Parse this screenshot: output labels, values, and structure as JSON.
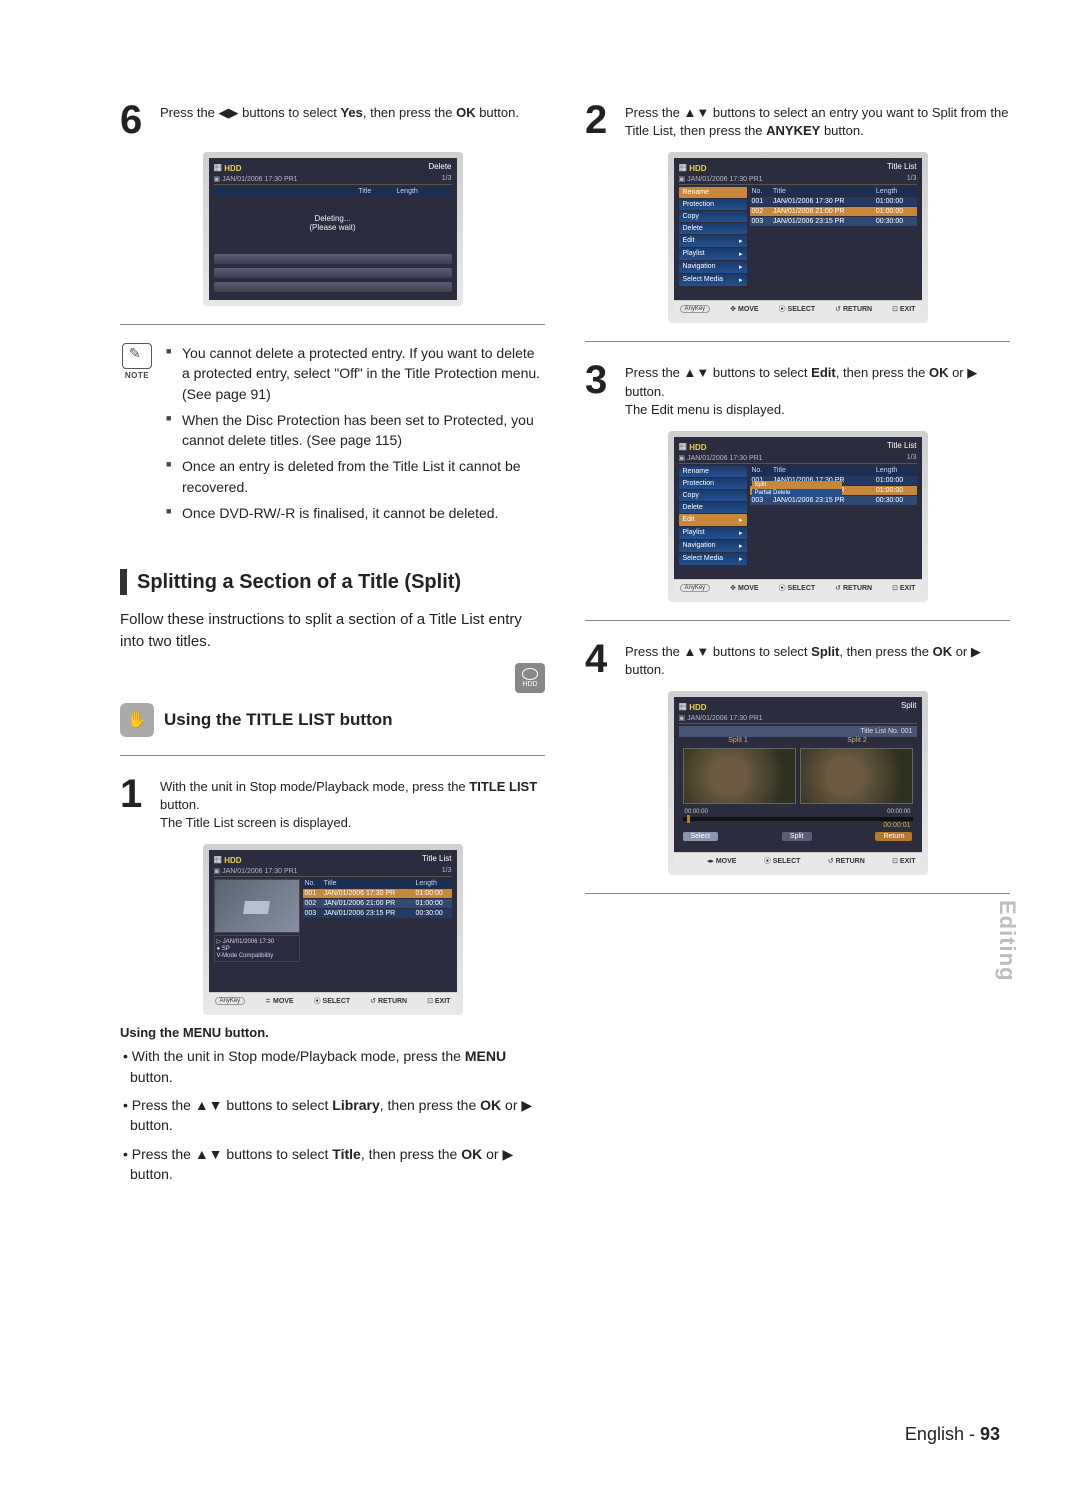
{
  "glyphs": {
    "left_right": "◀▶",
    "up_down": "▲▼",
    "play": "▶",
    "move4": "✥",
    "updown_small": "≑"
  },
  "left": {
    "step6": {
      "num": "6",
      "text_a": "Press the ",
      "text_b": " buttons to select ",
      "bold1": "Yes",
      "text_c": ", then press the ",
      "bold2": "OK",
      "text_d": " button."
    },
    "tv6": {
      "top_l": "HDD",
      "top_r": "Delete",
      "sub_l": "JAN/01/2006 17:30 PR1",
      "sub_r": "1/3",
      "thead": [
        "Title",
        "Length"
      ],
      "mid1": "Deleting...",
      "mid2": "(Please wait)"
    },
    "notes": [
      "You cannot delete a protected entry. If you want to delete a protected entry, select \"Off\" in the Title Protection menu. (See page 91)",
      "When the Disc Protection has been set to Protected, you cannot delete titles. (See page 115)",
      "Once an entry is deleted from the Title List it cannot be recovered.",
      "Once DVD-RW/-R is finalised, it cannot be deleted."
    ],
    "note_label": "NOTE",
    "section_title": "Splitting a Section of a Title (Split)",
    "section_body": "Follow these instructions to split a section of a Title List entry into two titles.",
    "hdd_label": "HDD",
    "sub_title": "Using the TITLE LIST button",
    "step1": {
      "num": "1",
      "text_a": "With the unit in Stop mode/Playback mode, press the ",
      "bold1": "TITLE LIST",
      "text_b": " button.",
      "text_c": "The Title List screen is displayed."
    },
    "tv1": {
      "top_l": "HDD",
      "top_r": "Title List",
      "sub_l": "JAN/01/2006 17:30 PR1",
      "sub_r": "1/3",
      "thead": [
        "No.",
        "Title",
        "Length"
      ],
      "rows": [
        [
          "001",
          "JAN/01/2006 17:30 PR",
          "01:00:00"
        ],
        [
          "002",
          "JAN/01/2006 21:00 PR",
          "01:00:00"
        ],
        [
          "003",
          "JAN/01/2006 23:15 PR",
          "00:30:00"
        ]
      ],
      "info": [
        "JAN/01/2006 17:30",
        "SP",
        "V-Mode Compatibility"
      ]
    },
    "menu_head": "Using the MENU button.",
    "menu_items": [
      {
        "a": "With the unit in Stop mode/Playback mode, press the ",
        "b": "MENU",
        "c": " button."
      },
      {
        "a": "Press the ",
        "arrows": "▲▼",
        "b": " buttons to select ",
        "bold": "Library",
        "c": ", then press the ",
        "bold2": "OK",
        "d": " or ",
        "play": "▶",
        "e": " button."
      },
      {
        "a": "Press the ",
        "arrows": "▲▼",
        "b": " buttons to select ",
        "bold": "Title",
        "c": ", then press the ",
        "bold2": "OK",
        "d": " or ",
        "play": "▶",
        "e": " button."
      }
    ]
  },
  "right": {
    "step2": {
      "num": "2",
      "text_a": "Press the ",
      "text_b": " buttons to select an entry you want to Split from the Title List, then press the ",
      "bold1": "ANYKEY",
      "text_c": " button."
    },
    "menu_items": [
      "Rename",
      "Protection",
      "Copy",
      "Delete",
      "Edit",
      "Playlist",
      "Navigation",
      "Select Media"
    ],
    "edit_sub": [
      "Split",
      "Partial Delete"
    ],
    "tv_common": {
      "top_l": "HDD",
      "top_r": "Title List",
      "sub_l": "JAN/01/2006 17:30 PR1",
      "sub_r": "1/3",
      "thead": [
        "No.",
        "Title",
        "Length"
      ],
      "rows": [
        [
          "001",
          "JAN/01/2006 17:30 PR",
          "01:00:00"
        ],
        [
          "002",
          "JAN/01/2006 21:00 PR",
          "01:00:00"
        ],
        [
          "003",
          "JAN/01/2006 23:15 PR",
          "00:30:00"
        ]
      ]
    },
    "step3": {
      "num": "3",
      "text_a": "Press the ",
      "text_b": " buttons to select ",
      "bold1": "Edit",
      "text_c": ", then press the ",
      "bold2": "OK",
      "text_d": " or ",
      "text_e": " button.",
      "text_f": "The Edit menu is displayed."
    },
    "step4": {
      "num": "4",
      "text_a": "Press the ",
      "text_b": " buttons to select ",
      "bold1": "Split",
      "text_c": ", then press the ",
      "bold2": "OK",
      "text_d": " or ",
      "text_e": " button."
    },
    "tv4": {
      "top_l": "HDD",
      "top_r": "Split",
      "sub_l": "JAN/01/2006 17:30 PR1",
      "title_no": "Title List No. 001",
      "labels": [
        "Split 1",
        "Split 2"
      ],
      "times": [
        "00:00:00",
        "00:00:00"
      ],
      "timer": "00:00:01",
      "btns": [
        "Select",
        "Split",
        "Return"
      ]
    },
    "footer_keys": {
      "anykey": "AnyKey",
      "move": "MOVE",
      "select": "SELECT",
      "return": "RETURN",
      "exit": "EXIT"
    }
  },
  "side_tab": "Editing",
  "footer": {
    "lang": "English - ",
    "page": "93"
  }
}
